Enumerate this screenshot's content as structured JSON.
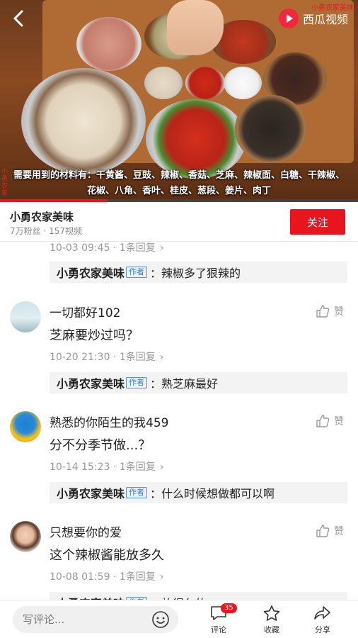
{
  "video": {
    "brand": "西瓜视频",
    "watermark_top": "小勇农家美味",
    "watermark_left": "小勇农家",
    "caption_line1": "需要用到的材料有：干黄酱、豆豉、辣椒、香菇、芝麻、辣椒面、白糖、干辣椒、",
    "caption_line2": "花椒、八角、香叶、桂皮、葱段、姜片、肉丁",
    "progress": 0.3
  },
  "channel": {
    "name": "小勇农家美味",
    "stats": "7万粉丝 · 157视频",
    "follow_label": "关注"
  },
  "comments": {
    "partial_meta": "10-03 09:45 · 1条回复",
    "partial_reply": {
      "name": "小勇农家美味",
      "tag": "作者",
      "text": "：辣椒多了狠辣的"
    },
    "items": [
      {
        "user": "一切都好102",
        "like": "赞",
        "text": "芝麻要炒过吗？",
        "meta": "10-20 21:30 · 1条回复",
        "reply": {
          "name": "小勇农家美味",
          "tag": "作者",
          "text": "：熟芝麻最好"
        }
      },
      {
        "user": "熟悉的你陌生的我459",
        "like": "赞",
        "text": "分不分季节做...？",
        "meta": "10-14 15:23 · 1条回复",
        "reply": {
          "name": "小勇农家美味",
          "tag": "作者",
          "text": "：什么时候想做都可以啊"
        }
      },
      {
        "user": "只想要你的爱",
        "like": "赞",
        "text": "这个辣椒酱能放多久",
        "meta": "10-08 01:59 · 1条回复",
        "reply": {
          "name": "小勇农家美味",
          "tag": "作者",
          "text": "：放得久的"
        }
      }
    ]
  },
  "bottom": {
    "input_placeholder": "写评论...",
    "comment_label": "评论",
    "comment_count": "35",
    "favorite_label": "收藏",
    "share_label": "分享"
  },
  "colors": {
    "accent": "#e8151e",
    "author_tag": "#3b78c8"
  }
}
